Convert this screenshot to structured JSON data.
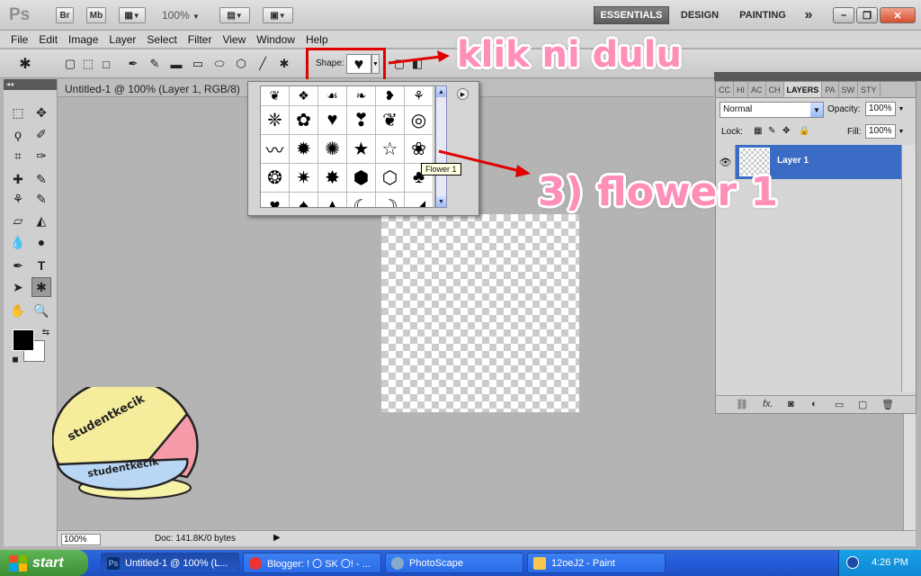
{
  "app": {
    "logo": "Ps",
    "bridge_label": "Br",
    "minibridge_label": "Mb",
    "zoom": "100%"
  },
  "workspaces": [
    "ESSENTIALS",
    "DESIGN",
    "PAINTING"
  ],
  "workspaces_more": "»",
  "menu": [
    "File",
    "Edit",
    "Image",
    "Layer",
    "Select",
    "Filter",
    "View",
    "Window",
    "Help"
  ],
  "options": {
    "shape_label": "Shape:",
    "shape_icon": "heart-shape"
  },
  "document": {
    "tab_title": "Untitled-1 @ 100% (Layer 1, RGB/8)"
  },
  "status": {
    "zoom": "100%",
    "doc": "Doc: 141.8K/0 bytes"
  },
  "picker": {
    "tooltip": "Flower 1"
  },
  "layers_panel": {
    "tabs": [
      "CC",
      "HI",
      "AC",
      "CH",
      "LAYERS",
      "PA",
      "SW",
      "STY"
    ],
    "active_tab": "LAYERS",
    "blend_mode": "Normal",
    "opacity_label": "Opacity:",
    "opacity": "100%",
    "lock_label": "Lock:",
    "fill_label": "Fill:",
    "fill": "100%",
    "layer_name": "Layer 1"
  },
  "annotations": {
    "step1": "klik ni dulu",
    "step3": "3) flower 1"
  },
  "watermark": {
    "text": "studentkecik"
  },
  "taskbar": {
    "start": "start",
    "tasks": [
      "Untitled-1 @ 100% (L...",
      "Blogger: ! 〇 SK 〇! - ...",
      "PhotoScape",
      "12oeJ2 - Paint"
    ],
    "time": "4:26 PM"
  },
  "colors": {
    "annotation_pink": "#ff8fb8",
    "highlight_red": "#e00000",
    "selection_blue": "#3a6cc6"
  }
}
